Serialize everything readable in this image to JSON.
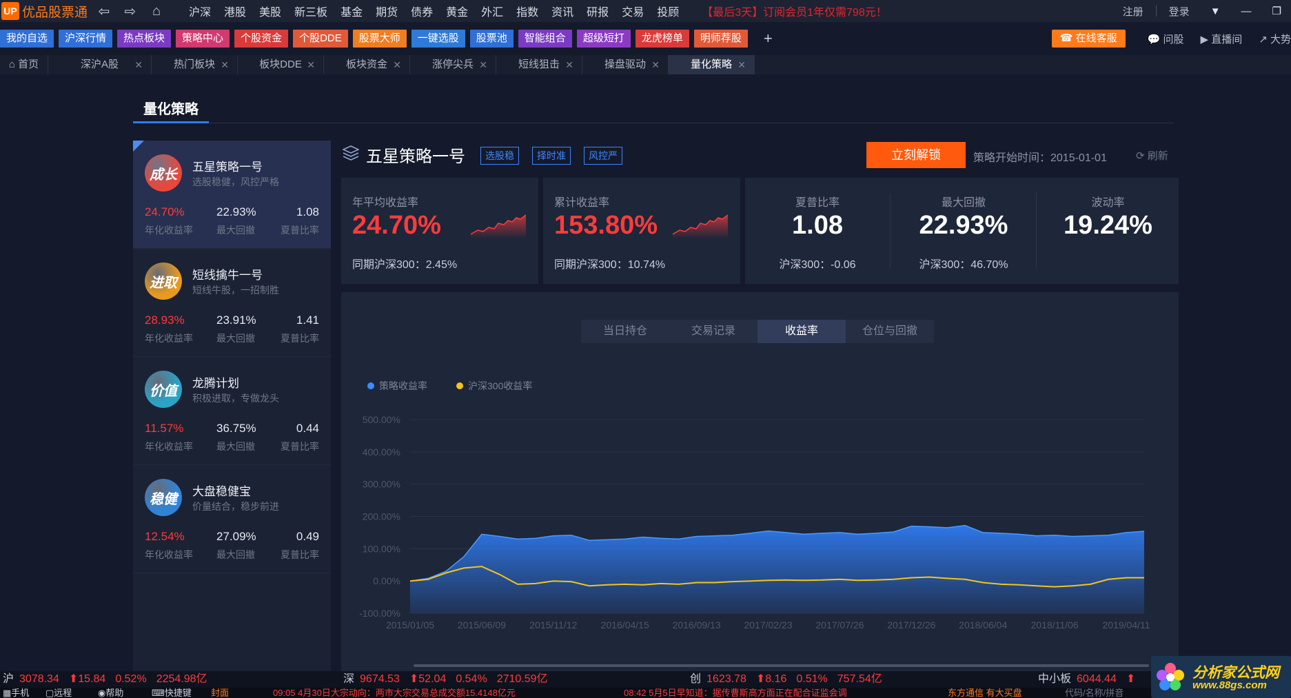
{
  "app": {
    "logo_mark": "UP",
    "name": "优品股票通"
  },
  "topnav": {
    "items": [
      "沪深",
      "港股",
      "美股",
      "新三板",
      "基金",
      "期货",
      "债券",
      "黄金",
      "外汇",
      "指数",
      "资讯",
      "研报",
      "交易",
      "投顾"
    ],
    "promo": "【最后3天】订阅会员1年仅需798元！",
    "register": "注册",
    "login": "登录"
  },
  "quickbar": {
    "buttons": [
      {
        "label": "我的自选",
        "color": "#2f6fd6"
      },
      {
        "label": "沪深行情",
        "color": "#2f6fd6"
      },
      {
        "label": "热点板块",
        "color": "#7a3bc2"
      },
      {
        "label": "策略中心",
        "color": "#d13a6f"
      },
      {
        "label": "个股资金",
        "color": "#d93a3a"
      },
      {
        "label": "个股DDE",
        "color": "#e05a3a"
      },
      {
        "label": "股票大师",
        "color": "#ef7d22"
      },
      {
        "label": "一键选股",
        "color": "#2f7ad6"
      },
      {
        "label": "股票池",
        "color": "#2f6fd6"
      },
      {
        "label": "智能组合",
        "color": "#7a3bc2"
      },
      {
        "label": "超级短打",
        "color": "#8a3bc2"
      },
      {
        "label": "龙虎榜单",
        "color": "#d93a3a"
      },
      {
        "label": "明师荐股",
        "color": "#e05a3a"
      }
    ],
    "online_service": "在线客服",
    "ask": "问股",
    "live": "直播间",
    "cut": "大势"
  },
  "tabs": [
    {
      "label": "首页",
      "closable": false
    },
    {
      "label": "深沪A股",
      "closable": true
    },
    {
      "label": "热门板块",
      "closable": true
    },
    {
      "label": "板块DDE",
      "closable": true
    },
    {
      "label": "板块资金",
      "closable": true
    },
    {
      "label": "涨停尖兵",
      "closable": true
    },
    {
      "label": "短线狙击",
      "closable": true
    },
    {
      "label": "操盘驱动",
      "closable": true
    },
    {
      "label": "量化策略",
      "closable": true,
      "active": true
    }
  ],
  "page": {
    "title": "量化策略"
  },
  "strategies": [
    {
      "badge": "成长",
      "badge_color": "#e8483b",
      "name": "五星策略一号",
      "desc": "选股稳健，风控严格",
      "annual": "24.70%",
      "drawdown": "22.93%",
      "sharpe": "1.08",
      "active": true
    },
    {
      "badge": "进取",
      "badge_color": "#e89a1f",
      "name": "短线擒牛一号",
      "desc": "短线牛股，一招制胜",
      "annual": "28.93%",
      "drawdown": "23.91%",
      "sharpe": "1.41"
    },
    {
      "badge": "价值",
      "badge_color": "#2aa3c7",
      "name": "龙腾计划",
      "desc": "积极进取，专做龙头",
      "annual": "11.57%",
      "drawdown": "36.75%",
      "sharpe": "0.44"
    },
    {
      "badge": "稳健",
      "badge_color": "#2f84d8",
      "name": "大盘稳健宝",
      "desc": "价量结合，稳步前进",
      "annual": "12.54%",
      "drawdown": "27.09%",
      "sharpe": "0.49"
    }
  ],
  "metric_labels": {
    "annual": "年化收益率",
    "drawdown": "最大回撤",
    "sharpe": "夏普比率"
  },
  "detail": {
    "name": "五星策略一号",
    "tags": [
      "选股稳",
      "择时准",
      "风控严"
    ],
    "unlock": "立刻解锁",
    "start_time": "策略开始时间：2015-01-01",
    "refresh": "刷新"
  },
  "stats": {
    "annual": {
      "label": "年平均收益率",
      "value": "24.70%",
      "sub": "同期沪深300：2.45%"
    },
    "cumulative": {
      "label": "累计收益率",
      "value": "153.80%",
      "sub": "同期沪深300：10.74%"
    },
    "sharpe": {
      "label": "夏普比率",
      "value": "1.08",
      "sub": "沪深300：-0.06"
    },
    "drawdown": {
      "label": "最大回撤",
      "value": "22.93%",
      "sub": "沪深300：46.70%"
    },
    "volatility": {
      "label": "波动率",
      "value": "19.24%"
    }
  },
  "chart_tabs": [
    "当日持仓",
    "交易记录",
    "收益率",
    "仓位与回撤"
  ],
  "chart_data": {
    "type": "area",
    "x": [
      "2015/01/05",
      "2015/02/13",
      "2015/03/24",
      "2015/05/04",
      "2015/06/09",
      "2015/07/16",
      "2015/08/24",
      "2015/09/30",
      "2015/11/12",
      "2015/12/21",
      "2016/02/01",
      "2016/03/09",
      "2016/04/15",
      "2016/05/25",
      "2016/07/01",
      "2016/08/08",
      "2016/09/13",
      "2016/10/24",
      "2016/12/01",
      "2017/01/10",
      "2017/02/23",
      "2017/04/05",
      "2017/05/15",
      "2017/06/20",
      "2017/07/26",
      "2017/09/01",
      "2017/10/17",
      "2017/11/20",
      "2017/12/26",
      "2018/02/01",
      "2018/03/15",
      "2018/04/25",
      "2018/06/04",
      "2018/07/10",
      "2018/08/15",
      "2018/09/25",
      "2018/11/06",
      "2018/12/12",
      "2019/01/22",
      "2019/03/05",
      "2019/04/11",
      "2019/04/30"
    ],
    "series": [
      {
        "name": "策略收益率",
        "color": "#3a8cff",
        "values": [
          0,
          8,
          30,
          75,
          145,
          138,
          130,
          132,
          140,
          142,
          126,
          128,
          130,
          136,
          132,
          130,
          138,
          140,
          142,
          148,
          155,
          150,
          145,
          148,
          150,
          145,
          148,
          152,
          170,
          168,
          165,
          172,
          150,
          148,
          145,
          140,
          142,
          138,
          140,
          142,
          150,
          154
        ]
      },
      {
        "name": "沪深300收益率",
        "color": "#f5c518",
        "values": [
          0,
          5,
          25,
          40,
          45,
          20,
          -10,
          -8,
          0,
          -2,
          -15,
          -12,
          -10,
          -12,
          -8,
          -10,
          -5,
          -5,
          -2,
          0,
          2,
          3,
          2,
          3,
          5,
          2,
          3,
          5,
          10,
          12,
          8,
          5,
          -5,
          -10,
          -12,
          -15,
          -18,
          -15,
          -10,
          5,
          10,
          10
        ]
      }
    ],
    "ylim": [
      -100,
      500
    ],
    "yticks": [
      "500.00%",
      "400.00%",
      "300.00%",
      "200.00%",
      "100.00%",
      "0.00%",
      "-100.00%"
    ],
    "xticks": [
      "2015/01/05",
      "2015/06/09",
      "2015/11/12",
      "2016/04/15",
      "2016/09/13",
      "2017/02/23",
      "2017/07/26",
      "2017/12/26",
      "2018/06/04",
      "2018/11/06",
      "2019/04/11"
    ],
    "legend": "top-left",
    "grid": true
  },
  "ticker": [
    {
      "market": "沪",
      "value": "3078.34",
      "change": "⬆15.84",
      "pct": "0.52%",
      "amount": "2254.98亿"
    },
    {
      "market": "深",
      "value": "9674.53",
      "change": "⬆52.04",
      "pct": "0.54%",
      "amount": "2710.59亿"
    },
    {
      "market": "创",
      "value": "1623.78",
      "change": "⬆8.16",
      "pct": "0.51%",
      "amount": "757.54亿"
    },
    {
      "market": "中小板",
      "value": "6044.44",
      "change": "⬆"
    }
  ],
  "statusbar": {
    "items": [
      "手机",
      "远程",
      "帮助",
      "快捷键",
      "封面"
    ],
    "news1": "09:05 4月30日大宗动向：两市大宗交易总成交额15.4148亿元",
    "news2": "08:42 5月5日早知道：据传曹斯高方面正在配合证监会调",
    "right1": "东方通信 有大买盘",
    "right2": "代码/名称/拼音"
  },
  "watermark": {
    "line1": "分析家公式网",
    "line2": "www.88gs.com"
  }
}
